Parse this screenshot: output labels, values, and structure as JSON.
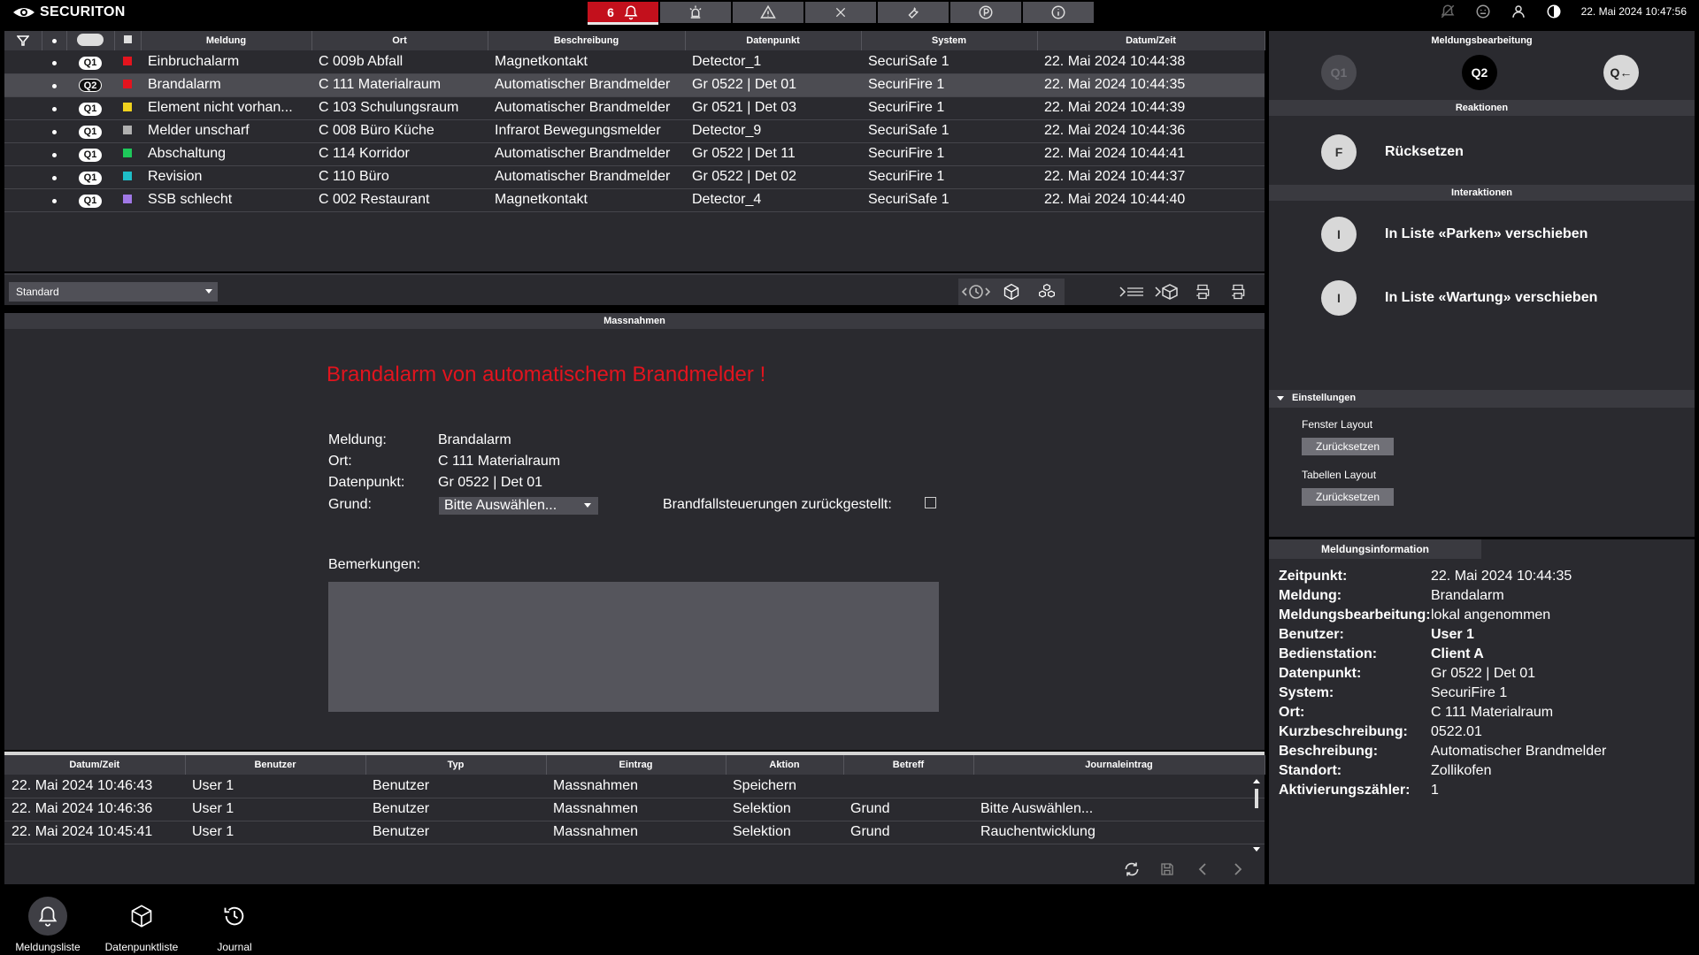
{
  "app": {
    "brand": "SECURITON",
    "clock": "22. Mai 2024 10:47:56"
  },
  "top_tabs": [
    {
      "label": "6",
      "icon": "bell-icon",
      "active": true
    },
    {
      "label": "",
      "icon": "siren-icon"
    },
    {
      "label": "",
      "icon": "warning-icon"
    },
    {
      "label": "",
      "icon": "close-icon"
    },
    {
      "label": "",
      "icon": "wrench-icon"
    },
    {
      "label": "",
      "icon": "parking-icon"
    },
    {
      "label": "",
      "icon": "info-icon"
    }
  ],
  "alarm_list": {
    "columns": [
      "",
      "",
      "",
      "",
      "Meldung",
      "Ort",
      "Beschreibung",
      "Datenpunkt",
      "System",
      "Datum/Zeit"
    ],
    "rows": [
      {
        "q": "Q1",
        "color": "#e4141e",
        "meldung": "Einbruchalarm",
        "ort": "C 009b Abfall",
        "beschreibung": "Magnetkontakt",
        "datenpunkt": "Detector_1",
        "system": "SecuriSafe 1",
        "datum": "22. Mai 2024 10:44:38"
      },
      {
        "q": "Q2",
        "color": "#e4141e",
        "meldung": "Brandalarm",
        "ort": "C 111 Materialraum",
        "beschreibung": "Automatischer Brandmelder",
        "datenpunkt": "Gr 0522 | Det 01",
        "system": "SecuriFire 1",
        "datum": "22. Mai 2024 10:44:35",
        "selected": true
      },
      {
        "q": "Q1",
        "color": "#f0d21e",
        "meldung": "Element nicht vorhan...",
        "ort": "C 103 Schulungsraum",
        "beschreibung": "Automatischer Brandmelder",
        "datenpunkt": "Gr 0521 | Det 03",
        "system": "SecuriFire 1",
        "datum": "22. Mai 2024 10:44:39"
      },
      {
        "q": "Q1",
        "color": "#b0b0b0",
        "meldung": "Melder unscharf",
        "ort": "C 008 Büro Küche",
        "beschreibung": "Infrarot Bewegungsmelder",
        "datenpunkt": "Detector_9",
        "system": "SecuriSafe 1",
        "datum": "22. Mai 2024 10:44:36"
      },
      {
        "q": "Q1",
        "color": "#1ec85a",
        "meldung": "Abschaltung",
        "ort": "C 114 Korridor",
        "beschreibung": "Automatischer Brandmelder",
        "datenpunkt": "Gr 0522 | Det 11",
        "system": "SecuriFire 1",
        "datum": "22. Mai 2024 10:44:41"
      },
      {
        "q": "Q1",
        "color": "#1ebec8",
        "meldung": "Revision",
        "ort": "C 110 Büro",
        "beschreibung": "Automatischer Brandmelder",
        "datenpunkt": "Gr 0522 | Det 02",
        "system": "SecuriFire 1",
        "datum": "22. Mai 2024 10:44:37"
      },
      {
        "q": "Q1",
        "color": "#a078e6",
        "meldung": "SSB schlecht",
        "ort": "C 002 Restaurant",
        "beschreibung": "Magnetkontakt",
        "datenpunkt": "Detector_4",
        "system": "SecuriSafe 1",
        "datum": "22. Mai 2024 10:44:40"
      }
    ],
    "view_select": "Standard"
  },
  "massnahmen": {
    "header": "Massnahmen",
    "title": "Brandalarm von automatischem Brandmelder !",
    "fields": [
      {
        "label": "Meldung:",
        "value": "Brandalarm"
      },
      {
        "label": "Ort:",
        "value": "C 111 Materialraum"
      },
      {
        "label": "Datenpunkt:",
        "value": "Gr 0522 | Det 01"
      }
    ],
    "grund_label": "Grund:",
    "grund_value": "Bitte Auswählen...",
    "brand_label": "Brandfallsteuerungen zurückgestellt:",
    "brand_checked": false,
    "remarks_label": "Bemerkungen:",
    "remarks_value": ""
  },
  "journal": {
    "columns": [
      "Datum/Zeit",
      "Benutzer",
      "Typ",
      "Eintrag",
      "Aktion",
      "Betreff",
      "Journaleintrag"
    ],
    "rows": [
      [
        "22. Mai 2024 10:46:43",
        "User 1",
        "Benutzer",
        "Massnahmen",
        "Speichern",
        "",
        ""
      ],
      [
        "22. Mai 2024 10:46:36",
        "User 1",
        "Benutzer",
        "Massnahmen",
        "Selektion",
        "Grund",
        "Bitte Auswählen..."
      ],
      [
        "22. Mai 2024 10:45:41",
        "User 1",
        "Benutzer",
        "Massnahmen",
        "Selektion",
        "Grund",
        "Rauchentwicklung"
      ]
    ]
  },
  "meldungsbearbeitung": {
    "header": "Meldungsbearbeitung",
    "queue_buttons": [
      "Q1",
      "Q2",
      "Q←"
    ],
    "reaktionen_header": "Reaktionen",
    "reaktionen": [
      {
        "key": "F",
        "label": "Rücksetzen"
      }
    ],
    "interaktionen_header": "Interaktionen",
    "interaktionen": [
      {
        "key": "I",
        "label": "In Liste «Parken» verschieben"
      },
      {
        "key": "I",
        "label": "In Liste «Wartung» verschieben"
      }
    ],
    "einstellungen": {
      "header": "Einstellungen",
      "fenster_label": "Fenster Layout",
      "fenster_button": "Zurücksetzen",
      "tabellen_label": "Tabellen Layout",
      "tabellen_button": "Zurücksetzen"
    }
  },
  "meldungsinformation": {
    "tab": "Meldungsinformation",
    "rows": [
      {
        "k": "Zeitpunkt:",
        "v": "22. Mai 2024 10:44:35"
      },
      {
        "k": "Meldung:",
        "v": "Brandalarm"
      },
      {
        "k": "Meldungsbearbeitung:",
        "v": "lokal angenommen"
      },
      {
        "k": "Benutzer:",
        "v": "User 1",
        "bold": true
      },
      {
        "k": "Bedienstation:",
        "v": "Client A",
        "bold": true
      },
      {
        "k": "Datenpunkt:",
        "v": "Gr 0522 | Det 01"
      },
      {
        "k": "System:",
        "v": "SecuriFire 1"
      },
      {
        "k": "Ort:",
        "v": "C 111 Materialraum"
      },
      {
        "k": "Kurzbeschreibung:",
        "v": "0522.01"
      },
      {
        "k": "Beschreibung:",
        "v": "Automatischer Brandmelder"
      },
      {
        "k": "Standort:",
        "v": "Zollikofen"
      },
      {
        "k": "Aktivierungszähler:",
        "v": "1"
      }
    ]
  },
  "bottom_nav": [
    {
      "label": "Meldungsliste",
      "icon": "bell-icon",
      "active": true
    },
    {
      "label": "Datenpunktliste",
      "icon": "cube-icon"
    },
    {
      "label": "Journal",
      "icon": "history-icon"
    }
  ]
}
